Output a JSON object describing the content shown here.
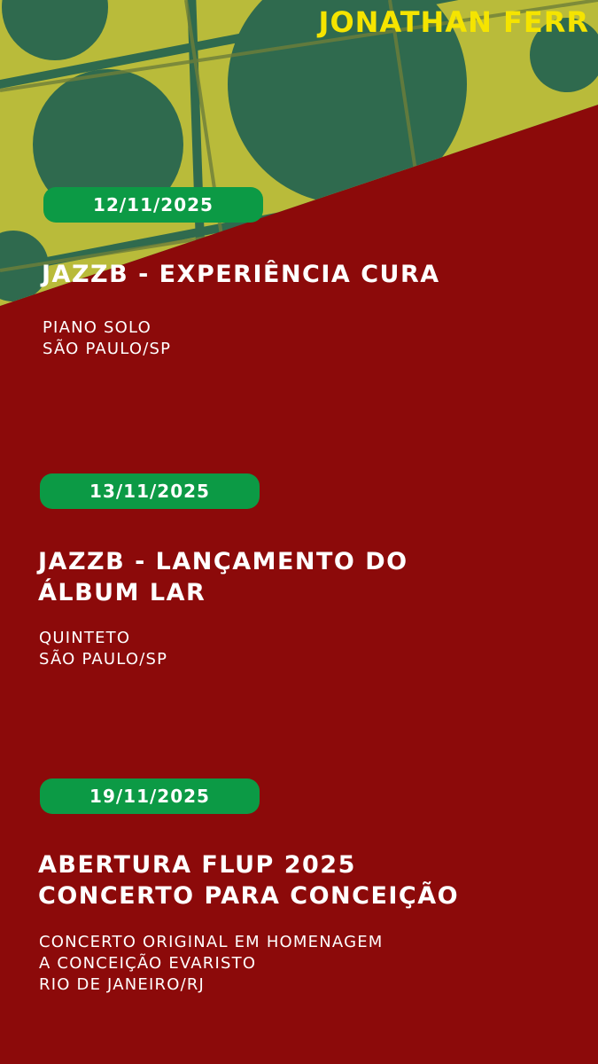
{
  "header": {
    "artist_name": "JONATHAN FERR"
  },
  "colors": {
    "background": "#8c0a0a",
    "accent_yellow": "#f5e400",
    "pill_green": "#0c9a45",
    "art_teal": "#2f6a4e",
    "art_yellow": "#b9bb3a",
    "text": "#ffffff"
  },
  "events": [
    {
      "date": "12/11/2025",
      "title_lines": [
        "JAZZB - EXPERIÊNCIA CURA"
      ],
      "detail_lines": [
        "PIANO SOLO",
        "SÃO PAULO/SP"
      ]
    },
    {
      "date": "13/11/2025",
      "title_lines": [
        "JAZZB - LANÇAMENTO DO",
        "ÁLBUM LAR"
      ],
      "detail_lines": [
        "QUINTETO",
        "SÃO PAULO/SP"
      ]
    },
    {
      "date": "19/11/2025",
      "title_lines": [
        "ABERTURA FLUP 2025",
        "CONCERTO PARA CONCEIÇÃO"
      ],
      "detail_lines": [
        "CONCERTO ORIGINAL EM HOMENAGEM",
        "A CONCEIÇÃO EVARISTO",
        "RIO DE JANEIRO/RJ"
      ]
    }
  ]
}
